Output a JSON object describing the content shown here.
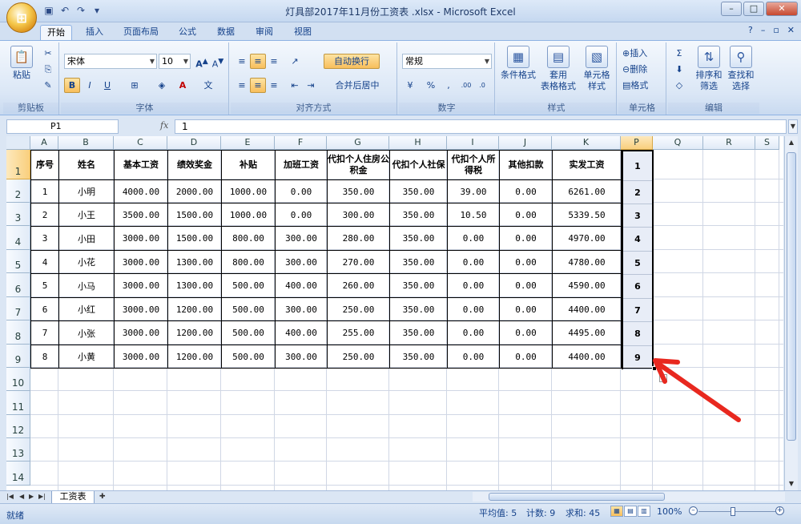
{
  "window": {
    "title": "灯具部2017年11月份工资表 .xlsx - Microsoft Excel",
    "office_button": "⊞"
  },
  "ribbon_tabs": [
    "开始",
    "插入",
    "页面布局",
    "公式",
    "数据",
    "审阅",
    "视图"
  ],
  "font": {
    "name": "宋体",
    "size": "10"
  },
  "number_format": "常规",
  "groups": {
    "clipboard": "剪贴板",
    "font": "字体",
    "alignment": "对齐方式",
    "number": "数字",
    "styles": "样式",
    "cells": "单元格",
    "editing": "编辑"
  },
  "buttons": {
    "paste": "粘贴",
    "wrap_text": "自动换行",
    "merge_center": "合并后居中",
    "conditional_format": "条件格式",
    "format_table_1": "套用",
    "format_table_2": "表格格式",
    "cell_style_1": "单元格",
    "cell_style_2": "样式",
    "insert": "插入",
    "delete": "删除",
    "format": "格式",
    "sort_1": "排序和",
    "sort_2": "筛选",
    "find_1": "查找和",
    "find_2": "选择",
    "bold": "B",
    "italic": "I",
    "underline": "U",
    "percent": "%",
    "comma": ","
  },
  "formula_bar": {
    "name_box": "P1",
    "fx": "fx",
    "value": "1"
  },
  "columns": [
    "A",
    "B",
    "C",
    "D",
    "E",
    "F",
    "G",
    "H",
    "I",
    "J",
    "K",
    "P",
    "Q",
    "R",
    "S"
  ],
  "row_numbers": [
    "1",
    "2",
    "3",
    "4",
    "5",
    "6",
    "7",
    "8",
    "9",
    "10",
    "11",
    "12",
    "13",
    "14"
  ],
  "table": {
    "headers": [
      "序号",
      "姓名",
      "基本工资",
      "绩效奖金",
      "补贴",
      "加班工资",
      "代扣个人住房公积金",
      "代扣个人社保",
      "代扣个人所得税",
      "其他扣款",
      "实发工资"
    ],
    "rows": [
      [
        "1",
        "小明",
        "4000.00",
        "2000.00",
        "1000.00",
        "0.00",
        "350.00",
        "350.00",
        "39.00",
        "0.00",
        "6261.00"
      ],
      [
        "2",
        "小王",
        "3500.00",
        "1500.00",
        "1000.00",
        "0.00",
        "300.00",
        "350.00",
        "10.50",
        "0.00",
        "5339.50"
      ],
      [
        "3",
        "小田",
        "3000.00",
        "1500.00",
        "800.00",
        "300.00",
        "280.00",
        "350.00",
        "0.00",
        "0.00",
        "4970.00"
      ],
      [
        "4",
        "小花",
        "3000.00",
        "1300.00",
        "800.00",
        "300.00",
        "270.00",
        "350.00",
        "0.00",
        "0.00",
        "4780.00"
      ],
      [
        "5",
        "小马",
        "3000.00",
        "1300.00",
        "500.00",
        "400.00",
        "260.00",
        "350.00",
        "0.00",
        "0.00",
        "4590.00"
      ],
      [
        "6",
        "小红",
        "3000.00",
        "1200.00",
        "500.00",
        "300.00",
        "250.00",
        "350.00",
        "0.00",
        "0.00",
        "4400.00"
      ],
      [
        "7",
        "小张",
        "3000.00",
        "1200.00",
        "500.00",
        "400.00",
        "255.00",
        "350.00",
        "0.00",
        "0.00",
        "4495.00"
      ],
      [
        "8",
        "小黄",
        "3000.00",
        "1200.00",
        "500.00",
        "300.00",
        "250.00",
        "350.00",
        "0.00",
        "0.00",
        "4400.00"
      ]
    ]
  },
  "p_column": [
    "1",
    "2",
    "3",
    "4",
    "5",
    "6",
    "7",
    "8",
    "9"
  ],
  "sheet_tab": "工资表",
  "status": {
    "ready": "就绪",
    "average": "平均值: 5",
    "count": "计数: 9",
    "sum": "求和: 45",
    "zoom": "100%"
  }
}
